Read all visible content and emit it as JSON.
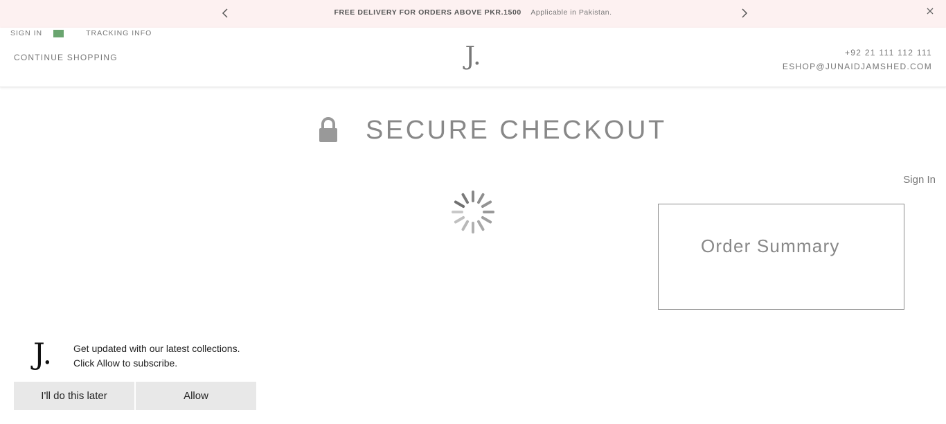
{
  "promo": {
    "headline": "FREE DELIVERY FOR ORDERS ABOVE PKR.1500",
    "subtext": "Applicable in Pakistan.",
    "background": "#fdf1f1"
  },
  "header": {
    "sign_in": "SIGN IN",
    "tracking": "TRACKING INFO",
    "continue": "CONTINUE SHOPPING",
    "logo": "J.",
    "phone": "+92 21 111 112 111",
    "email": "ESHOP@JUNAIDJAMSHED.COM",
    "flag_color": "#6aa56f"
  },
  "checkout": {
    "title": "SECURE CHECKOUT",
    "sign_in_link": "Sign In",
    "order_summary": "Order Summary"
  },
  "subscribe": {
    "logo": "J.",
    "line1": "Get updated with our latest collections.",
    "line2": "Click Allow to subscribe.",
    "later_button": "I'll do this later",
    "allow_button": "Allow"
  }
}
